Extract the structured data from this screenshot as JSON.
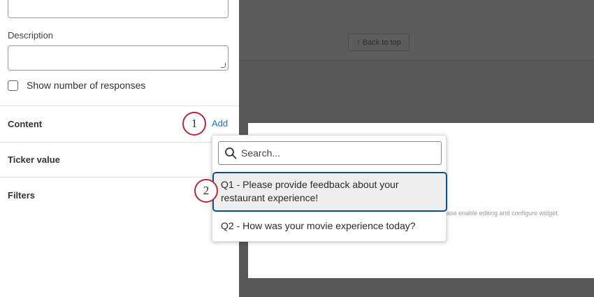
{
  "form": {
    "description_label": "Description",
    "show_responses_label": "Show number of responses",
    "sections": {
      "content": "Content",
      "ticker": "Ticker value",
      "filters": "Filters"
    },
    "add_label": "Add"
  },
  "callouts": [
    "1",
    "2"
  ],
  "canvas": {
    "back_to_top": "↑ Back to top",
    "widget_hint": "ase enable editing and configure widget."
  },
  "dropdown": {
    "search_placeholder": "Search...",
    "options": [
      "Q1 - Please provide feedback about your restaurant experience!",
      "Q2 - How was your movie experience today?"
    ]
  }
}
